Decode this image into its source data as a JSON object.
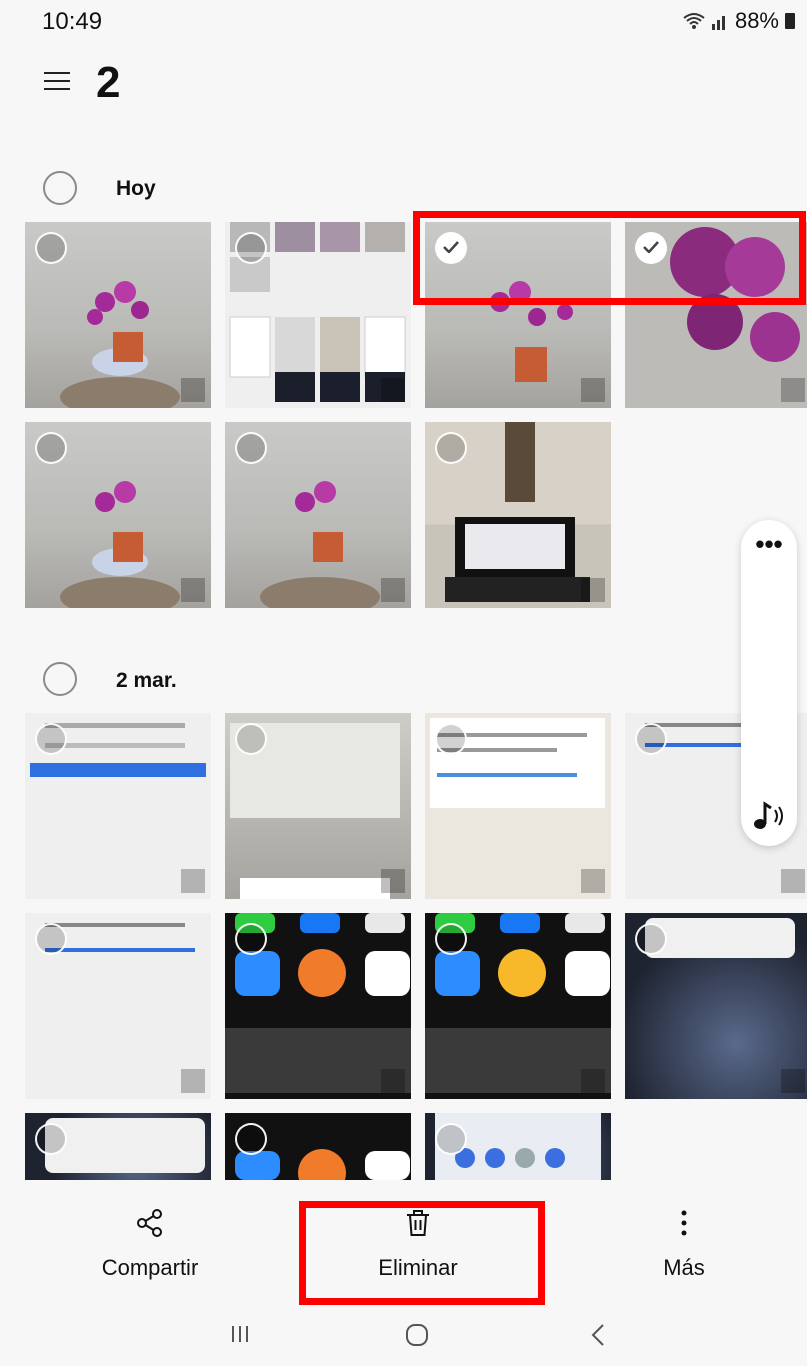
{
  "status_bar": {
    "time": "10:49",
    "battery": "88%"
  },
  "header": {
    "selected_count": "2"
  },
  "sections": [
    {
      "title": "Hoy"
    },
    {
      "title": "2 mar."
    }
  ],
  "thumbnails": {
    "hoy": [
      {
        "kind": "orchid",
        "selected": false
      },
      {
        "kind": "screenshots",
        "selected": false
      },
      {
        "kind": "orchid",
        "selected": true
      },
      {
        "kind": "orchid-closeup",
        "selected": true
      },
      {
        "kind": "orchid",
        "selected": false
      },
      {
        "kind": "orchid",
        "selected": false
      },
      {
        "kind": "laptop",
        "selected": false
      }
    ],
    "mar2": [
      {
        "kind": "screenshot-zoom-login",
        "selected": false
      },
      {
        "kind": "screenshot-whatsapp",
        "selected": false
      },
      {
        "kind": "screenshot-whatsapp",
        "selected": false
      },
      {
        "kind": "screenshot-chat",
        "selected": false
      },
      {
        "kind": "screenshot-chat",
        "selected": false
      },
      {
        "kind": "screenshot-apps",
        "selected": false
      },
      {
        "kind": "screenshot-apps",
        "selected": false
      },
      {
        "kind": "screenshot-notification",
        "selected": false
      },
      {
        "kind": "screenshot-notification",
        "selected": false
      },
      {
        "kind": "screenshot-apps",
        "selected": false
      },
      {
        "kind": "screenshot-quick-settings",
        "selected": false
      }
    ]
  },
  "side_panel": {
    "more_label": "•••"
  },
  "actions": {
    "share": "Compartir",
    "delete": "Eliminar",
    "more": "Más"
  },
  "colors": {
    "highlight": "#ff0000",
    "background": "#f7f7f7"
  }
}
